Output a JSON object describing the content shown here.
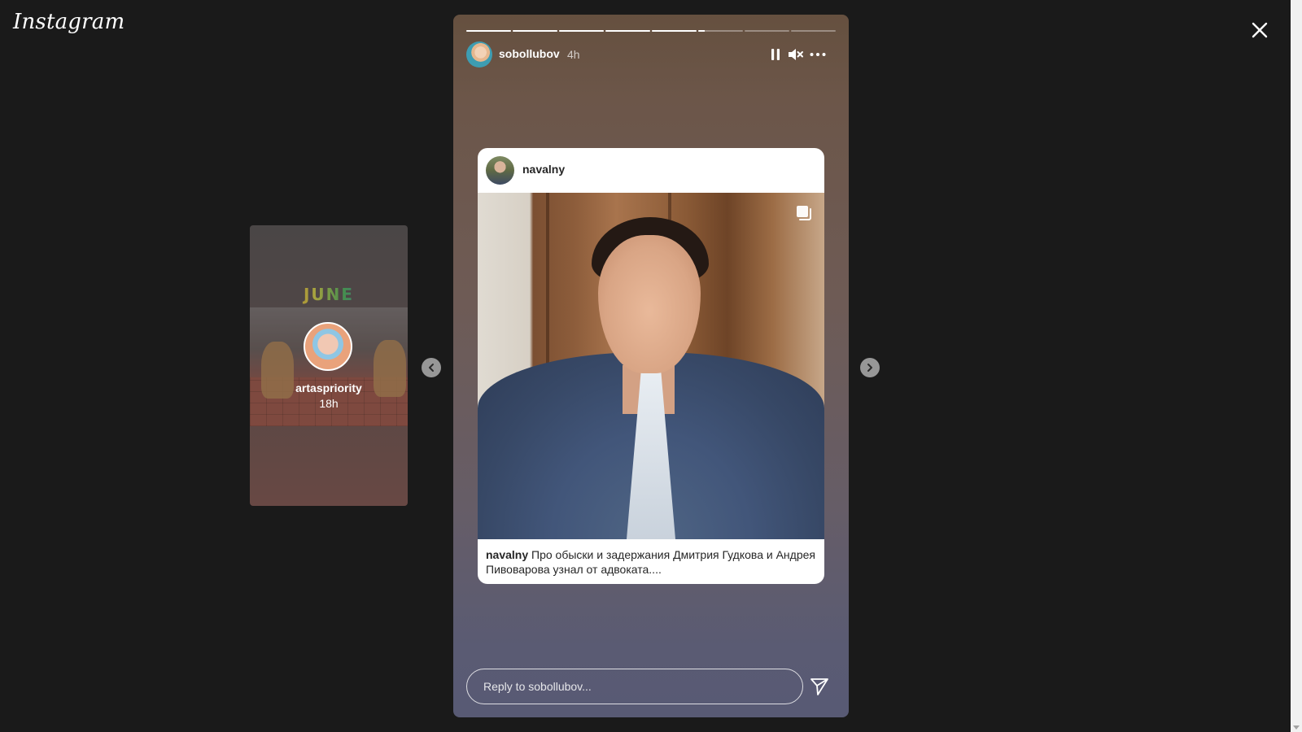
{
  "app": {
    "logo_text": "Instagram"
  },
  "icons": {
    "close": "close-icon",
    "prev": "chevron-left-icon",
    "next": "chevron-right-icon",
    "pause": "pause-icon",
    "mute": "volume-muted-icon",
    "more": "more-options-icon",
    "multi": "carousel-multiple-icon",
    "send": "send-paper-plane-icon"
  },
  "side_story": {
    "username": "artaspriority",
    "time": "18h",
    "image_text": "JUNE"
  },
  "story": {
    "username": "sobollubov",
    "time": "4h",
    "progress": [
      1,
      1,
      1,
      1,
      1,
      0.15,
      0,
      0
    ],
    "shared_post": {
      "username": "navalny",
      "caption_user": "navalny",
      "caption_text": "Про обыски и задержания Дмитрия Гудкова и Андрея Пивоварова узнал от адвоката...."
    },
    "reply_placeholder": "Reply to sobollubov..."
  },
  "colors": {
    "page_bg": "#1a1a1a",
    "text": "#ffffff",
    "card_text": "#262626"
  }
}
